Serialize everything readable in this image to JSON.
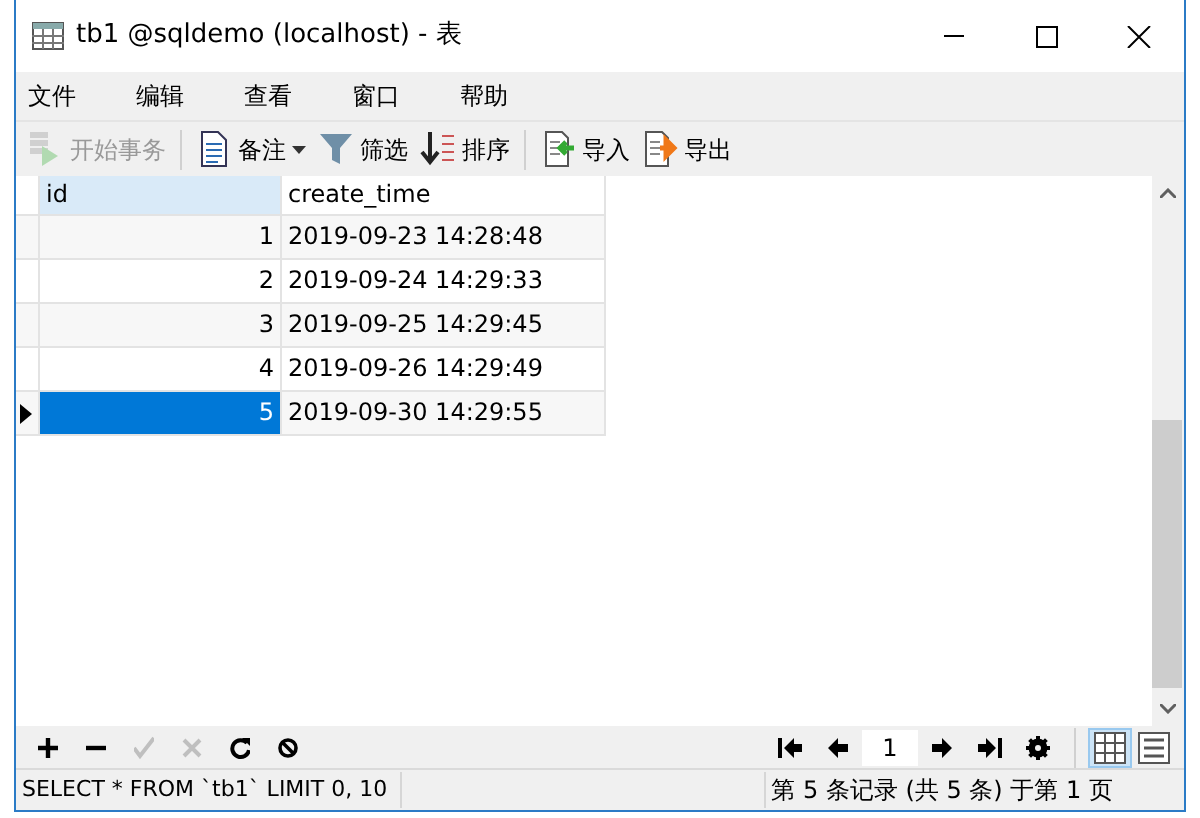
{
  "window": {
    "title": "tb1 @sqldemo (localhost) - 表"
  },
  "menu": [
    {
      "label": "文件"
    },
    {
      "label": "编辑"
    },
    {
      "label": "查看"
    },
    {
      "label": "窗口"
    },
    {
      "label": "帮助"
    }
  ],
  "toolbar": [
    [
      {
        "kind": "transaction",
        "label": "开始事务",
        "disabled": true,
        "dropdown": false
      }
    ],
    [
      {
        "kind": "note",
        "label": "备注",
        "disabled": false,
        "dropdown": true
      },
      {
        "kind": "filter",
        "label": "筛选",
        "disabled": false,
        "dropdown": false
      },
      {
        "kind": "sort",
        "label": "排序",
        "disabled": false,
        "dropdown": false
      }
    ],
    [
      {
        "kind": "import",
        "label": "导入",
        "disabled": false,
        "dropdown": false
      },
      {
        "kind": "export",
        "label": "导出",
        "disabled": false,
        "dropdown": false
      }
    ]
  ],
  "table": {
    "columns": [
      {
        "label": "id",
        "selected": true
      },
      {
        "label": "create_time",
        "selected": false
      }
    ],
    "rows": [
      {
        "cells": [
          "1",
          "2019-09-23 14:28:48"
        ],
        "selected": false
      },
      {
        "cells": [
          "2",
          "2019-09-24 14:29:33"
        ],
        "selected": false
      },
      {
        "cells": [
          "3",
          "2019-09-25 14:29:45"
        ],
        "selected": false
      },
      {
        "cells": [
          "4",
          "2019-09-26 14:29:49"
        ],
        "selected": false
      },
      {
        "cells": [
          "5",
          "2019-09-30 14:29:55"
        ],
        "selected": true
      }
    ]
  },
  "edit_buttons": [
    {
      "kind": "add",
      "disabled": false
    },
    {
      "kind": "remove",
      "disabled": false
    },
    {
      "kind": "apply",
      "disabled": true
    },
    {
      "kind": "cancel",
      "disabled": true
    },
    {
      "kind": "refresh",
      "disabled": false
    },
    {
      "kind": "stop",
      "disabled": false
    }
  ],
  "pager": {
    "page": "1"
  },
  "views": [
    {
      "kind": "grid",
      "selected": true
    },
    {
      "kind": "form",
      "selected": false
    }
  ],
  "status_bar": {
    "query": "SELECT * FROM `tb1` LIMIT 0, 10",
    "position": "第 5 条记录 (共 5 条) 于第 1 页"
  }
}
